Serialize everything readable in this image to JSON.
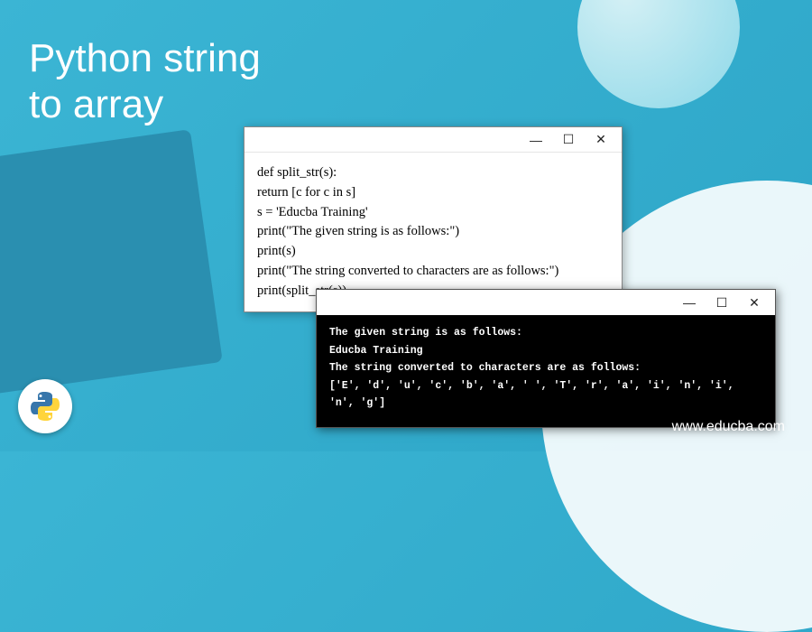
{
  "title_line1": "Python string",
  "title_line2": "to array",
  "window_controls": {
    "minimize": "—",
    "maximize": "☐",
    "close": "✕"
  },
  "code": {
    "line1": "def split_str(s):",
    "line2": "return [c for c in s]",
    "line3": "s = 'Educba Training'",
    "line4": "print(\"The given string is as follows:\")",
    "line5": "print(s)",
    "line6": "print(\"The string converted to characters are as follows:\")",
    "line7": "print(split_str(s))"
  },
  "terminal": {
    "line1": "The given string is as follows:",
    "line2": "Educba Training",
    "line3": "The string converted to characters are as follows:",
    "line4": "['E', 'd', 'u', 'c', 'b', 'a', ' ', 'T', 'r', 'a', 'i', 'n', 'i', 'n', 'g']"
  },
  "website": "www.educba.com"
}
